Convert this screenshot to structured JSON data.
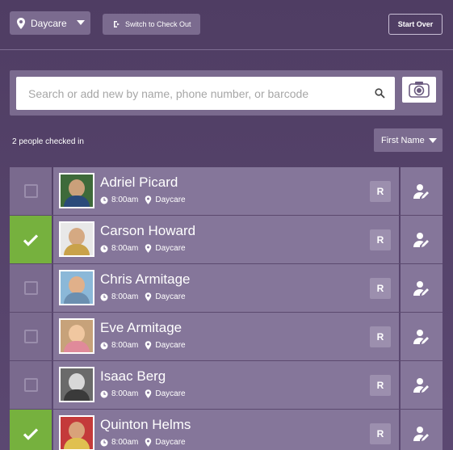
{
  "header": {
    "location": "Daycare",
    "switch_label": "Switch to Check Out",
    "start_over_label": "Start Over"
  },
  "search": {
    "placeholder": "Search or add new by name, phone number, or barcode"
  },
  "list_header": {
    "count_text": "2 people checked in",
    "sort_label": "First Name"
  },
  "colors": {
    "checked": "#76b13e",
    "row": "#85769a",
    "background": "#4f3d63"
  },
  "people": [
    {
      "name": "Adriel Picard",
      "time": "8:00am",
      "location": "Daycare",
      "checked": false,
      "r_label": "R"
    },
    {
      "name": "Carson Howard",
      "time": "8:00am",
      "location": "Daycare",
      "checked": true,
      "r_label": "R"
    },
    {
      "name": "Chris Armitage",
      "time": "8:00am",
      "location": "Daycare",
      "checked": false,
      "r_label": "R"
    },
    {
      "name": "Eve Armitage",
      "time": "8:00am",
      "location": "Daycare",
      "checked": false,
      "r_label": "R"
    },
    {
      "name": "Isaac Berg",
      "time": "8:00am",
      "location": "Daycare",
      "checked": false,
      "r_label": "R"
    },
    {
      "name": "Quinton Helms",
      "time": "8:00am",
      "location": "Daycare",
      "checked": true,
      "r_label": "R"
    }
  ]
}
